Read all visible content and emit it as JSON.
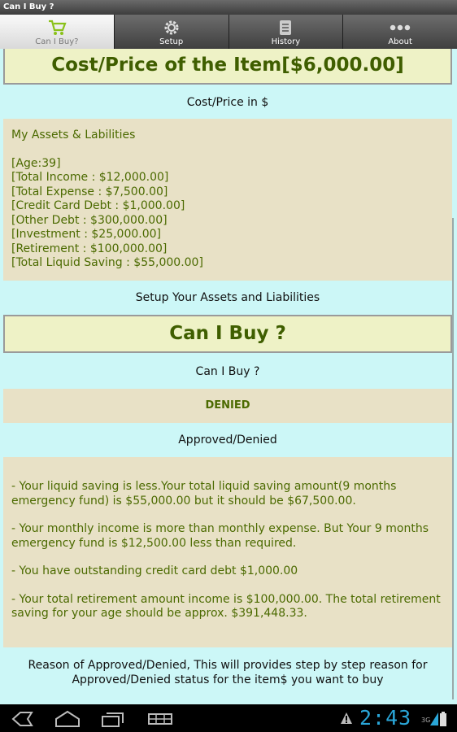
{
  "window": {
    "title": "Can I Buy ?"
  },
  "tabs": [
    {
      "label": "Can I Buy?",
      "icon": "cart-icon",
      "active": true
    },
    {
      "label": "Setup",
      "icon": "gear-icon",
      "active": false
    },
    {
      "label": "History",
      "icon": "notepad-icon",
      "active": false
    },
    {
      "label": "About",
      "icon": "dots-icon",
      "active": false
    }
  ],
  "cost": {
    "header": "Cost/Price of the Item[$6,000.00]",
    "caption": "Cost/Price in $"
  },
  "assets": {
    "title": "My Assets & Labilities",
    "lines": [
      "[Age:39]",
      "[Total Income : $12,000.00]",
      "[Total Expense : $7,500.00]",
      "[Credit Card Debt : $1,000.00]",
      "[Other Debt : $300,000.00]",
      "[Investment : $25,000.00]",
      "[Retirement : $100,000.00]",
      "[Total Liquid Saving : $55,000.00]"
    ],
    "caption": "Setup Your Assets and Liabilities"
  },
  "canbuy": {
    "header": "Can I Buy ?",
    "caption": "Can I Buy ?"
  },
  "result": {
    "status": "DENIED",
    "caption": "Approved/Denied",
    "reasons": [
      "- Your liquid saving is less.Your total liquid saving amount(9 months emergency fund) is $55,000.00 but it should be $67,500.00.",
      "- Your monthly income is more than monthly expense. But Your 9 months emergency fund is $12,500.00 less than required.",
      "- You have outstanding credit card debt $1,000.00",
      "- Your total retirement amount income is $100,000.00. The total retirement saving for your age should be approx. $391,448.33."
    ],
    "reason_caption": "Reason of Approved/Denied, This will provides step by step reason for Approved/Denied status for the item$ you want to buy"
  },
  "system_bar": {
    "time": "2:43",
    "signal": "3G",
    "accent": "#2aa6d8"
  },
  "colors": {
    "background": "#ccf7f7",
    "header_bg": "#eef2c6",
    "panel_bg": "#e8e1c6",
    "text_green": "#3f5e00"
  }
}
